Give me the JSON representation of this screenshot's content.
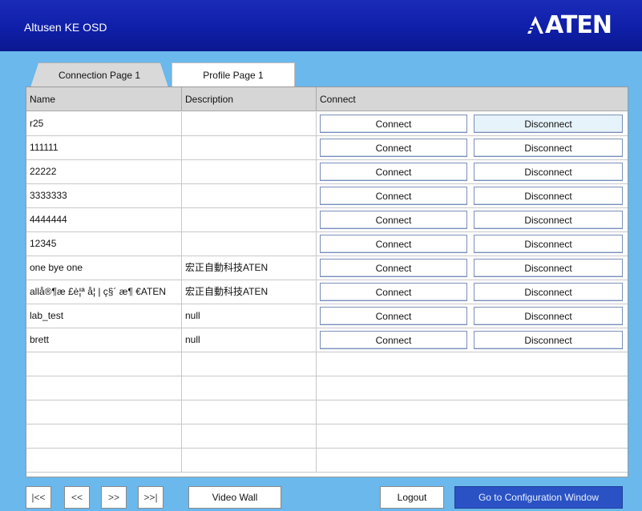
{
  "header": {
    "title": "Altusen KE OSD",
    "logo": "ATEN"
  },
  "tabs": [
    {
      "label": "Connection Page 1",
      "active": false
    },
    {
      "label": "Profile Page 1",
      "active": true
    }
  ],
  "table": {
    "columns": [
      "Name",
      "Description",
      "Connect"
    ],
    "connect_label": "Connect",
    "disconnect_label": "Disconnect",
    "rows": [
      {
        "name": "r25",
        "description": ""
      },
      {
        "name": "111111",
        "description": ""
      },
      {
        "name": "22222",
        "description": ""
      },
      {
        "name": "3333333",
        "description": ""
      },
      {
        "name": "4444444",
        "description": ""
      },
      {
        "name": "12345",
        "description": ""
      },
      {
        "name": "one bye one",
        "description": "宏正自動科技ATEN"
      },
      {
        "name": "allå®¶æ £è¦ª å¦ | ç§´ æ¶ €ATEN",
        "description": "宏正自動科技ATEN"
      },
      {
        "name": "lab_test",
        "description": "null"
      },
      {
        "name": "brett",
        "description": "null"
      }
    ]
  },
  "footer": {
    "first": "|<<",
    "prev": "<<",
    "next": ">>",
    "last": ">>|",
    "video_wall": "Video Wall",
    "logout": "Logout",
    "config": "Go to Configuration Window"
  }
}
